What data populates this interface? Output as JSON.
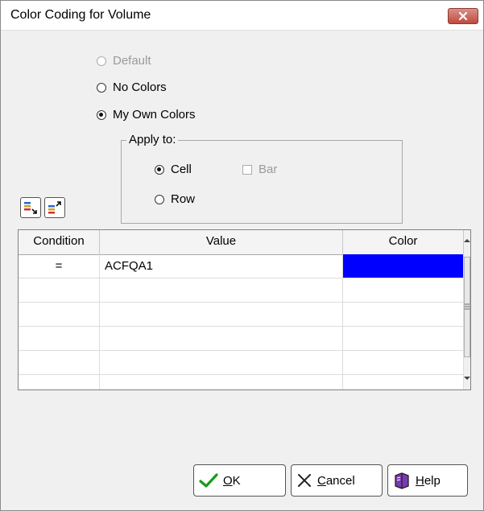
{
  "window": {
    "title": "Color Coding for Volume",
    "close_icon": "close-x-icon"
  },
  "color_mode": {
    "options": [
      {
        "label": "Default",
        "selected": false,
        "enabled": false
      },
      {
        "label": "No Colors",
        "selected": false,
        "enabled": true
      },
      {
        "label": "My Own Colors",
        "selected": true,
        "enabled": true
      }
    ]
  },
  "apply_to": {
    "legend": "Apply to:",
    "cell_label": "Cell",
    "cell_selected": true,
    "row_label": "Row",
    "row_selected": false,
    "bar_label": "Bar",
    "bar_checked": false,
    "bar_enabled": false
  },
  "toolbar": {
    "move_down_icon": "sort-down-icon",
    "move_up_icon": "sort-up-icon"
  },
  "grid": {
    "columns": [
      "Condition",
      "Value",
      "Color"
    ],
    "rows": [
      {
        "condition": "=",
        "value": "ACFQA1",
        "color": "#0000ff"
      },
      {
        "condition": "",
        "value": "",
        "color": ""
      },
      {
        "condition": "",
        "value": "",
        "color": ""
      },
      {
        "condition": "",
        "value": "",
        "color": ""
      },
      {
        "condition": "",
        "value": "",
        "color": ""
      },
      {
        "condition": "",
        "value": "",
        "color": ""
      }
    ]
  },
  "buttons": {
    "ok_label": "OK",
    "ok_mnemonic": "O",
    "cancel_label": "Cancel",
    "cancel_mnemonic": "C",
    "help_label": "Help",
    "help_mnemonic": "H"
  },
  "colors": {
    "blue_cell": "#0000ff",
    "ok_green": "#1a9a1a",
    "cancel_x": "#222222"
  }
}
